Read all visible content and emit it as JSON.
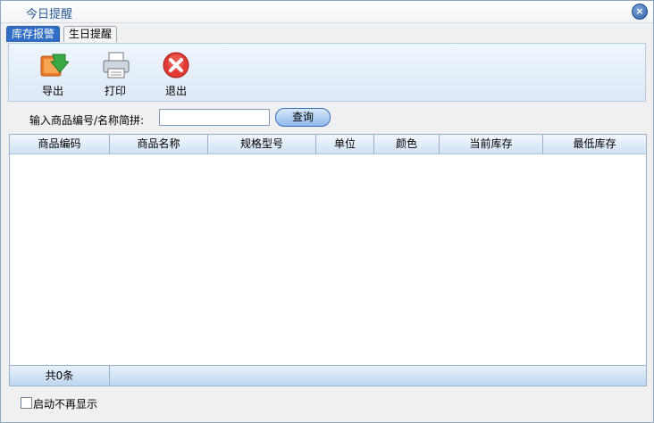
{
  "window": {
    "title": "今日提醒"
  },
  "tabs": [
    {
      "label": "库存报警",
      "active": true
    },
    {
      "label": "生日提醒",
      "active": false
    }
  ],
  "toolbar": {
    "export_label": "导出",
    "print_label": "打印",
    "exit_label": "退出"
  },
  "search": {
    "label": "输入商品编号/名称简拼:",
    "value": "",
    "placeholder": "",
    "button_label": "查询"
  },
  "grid": {
    "columns": [
      "商品编码",
      "商品名称",
      "规格型号",
      "单位",
      "颜色",
      "当前库存",
      "最低库存"
    ],
    "rows": [],
    "footer_count": "共0条"
  },
  "startup": {
    "label": "启动不再显示",
    "checked": false
  },
  "colors": {
    "accent": "#2f6ec4",
    "toolbar_bg": "#dde9f6",
    "grid_border": "#9bb2cc"
  }
}
